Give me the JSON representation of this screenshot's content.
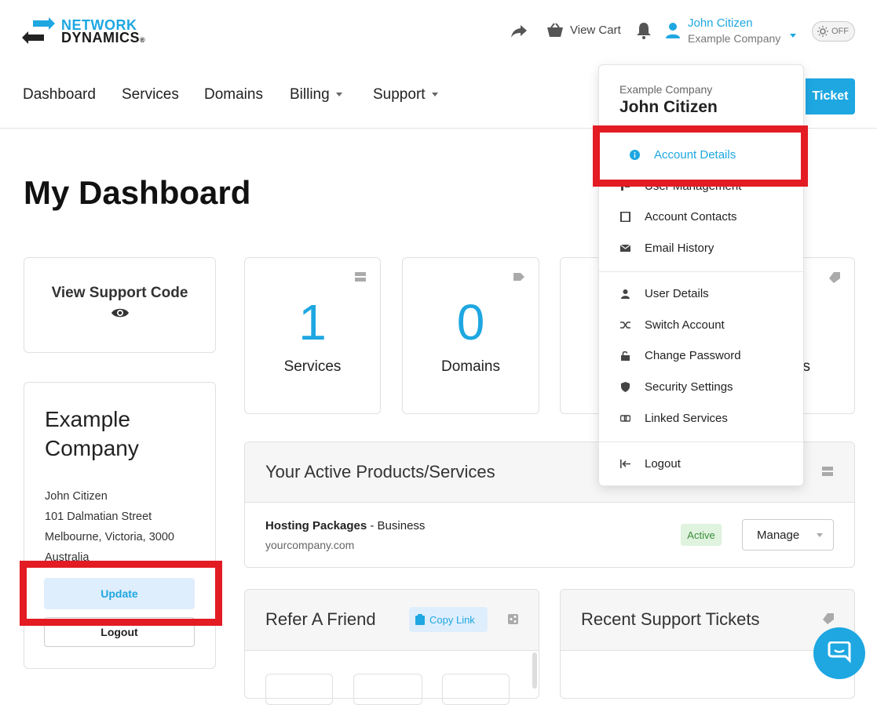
{
  "brand": {
    "line1": "NETWORK",
    "line2": "DYNAMICS",
    "mark": "®"
  },
  "header": {
    "view_cart": "View Cart",
    "user_name": "John Citizen",
    "user_company": "Example Company",
    "toggle_label": "OFF"
  },
  "nav": {
    "items": [
      "Dashboard",
      "Services",
      "Domains",
      "Billing",
      "Support"
    ],
    "open_ticket": "Ticket"
  },
  "page": {
    "title": "My Dashboard"
  },
  "support_code": {
    "label": "View Support Code"
  },
  "stats": [
    {
      "value": "1",
      "label": "Services"
    },
    {
      "value": "0",
      "label": "Domains"
    },
    {
      "value": "",
      "label": "s"
    }
  ],
  "company_card": {
    "title": "Example Company",
    "address": [
      "John Citizen",
      "101 Dalmatian Street",
      "Melbourne, Victoria, 3000",
      "Australia"
    ],
    "update": "Update",
    "logout": "Logout"
  },
  "products": {
    "title": "Your Active Products/Services",
    "item_name": "Hosting Packages",
    "item_plan": " - Business",
    "item_domain": "yourcompany.com",
    "status": "Active",
    "manage": "Manage"
  },
  "refer": {
    "title": "Refer A Friend",
    "copy_link": "Copy Link"
  },
  "tickets": {
    "title": "Recent Support Tickets"
  },
  "dropdown": {
    "company": "Example Company",
    "name": "John Citizen",
    "items": [
      "Account Details",
      "User Management",
      "Account Contacts",
      "Email History",
      "User Details",
      "Switch Account",
      "Change Password",
      "Security Settings",
      "Linked Services",
      "Logout"
    ]
  },
  "colors": {
    "accent": "#1ea7e1",
    "highlight": "#e31b23",
    "active_badge_bg": "#dff3df"
  }
}
